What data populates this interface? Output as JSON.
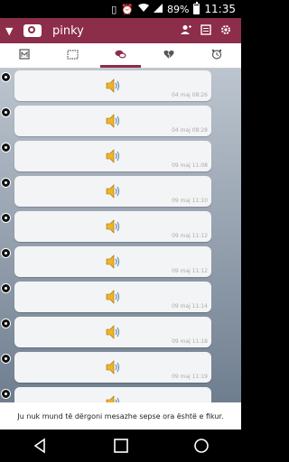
{
  "status_bar": {
    "battery": "89%",
    "time": "11:35",
    "icons": [
      "vibrate-icon",
      "alarm-icon",
      "wifi-icon",
      "signal-icon",
      "battery-icon"
    ]
  },
  "app_bar": {
    "title": "pinky",
    "actions": [
      "add-contact-icon",
      "notes-icon",
      "settings-icon"
    ]
  },
  "tabs": [
    {
      "name": "tab-profile",
      "icon": "profile-card-icon",
      "active": false
    },
    {
      "name": "tab-album",
      "icon": "photo-frame-icon",
      "active": false
    },
    {
      "name": "tab-chat",
      "icon": "chat-bubbles-icon",
      "active": true
    },
    {
      "name": "tab-broken-heart",
      "icon": "broken-heart-icon",
      "active": false
    },
    {
      "name": "tab-alarm",
      "icon": "alarm-clock-icon",
      "active": false
    }
  ],
  "messages": [
    {
      "type": "audio",
      "time": "04 maj 08:26"
    },
    {
      "type": "audio",
      "time": "04 maj 08:28"
    },
    {
      "type": "audio",
      "time": "09 maj 11:08"
    },
    {
      "type": "audio",
      "time": "09 maj 11:10"
    },
    {
      "type": "audio",
      "time": "09 maj 11:12"
    },
    {
      "type": "audio",
      "time": "09 maj 11:12"
    },
    {
      "type": "audio",
      "time": "09 maj 11:14"
    },
    {
      "type": "audio",
      "time": "09 maj 11:18"
    },
    {
      "type": "audio",
      "time": "09 maj 11:19"
    },
    {
      "type": "audio",
      "time": ""
    }
  ],
  "notice": "Ju nuk mund të dërgoni mesazhe sepse ora është e fikur.",
  "colors": {
    "accent": "#8c2d4a",
    "chat_top": "#bcc5cf",
    "chat_bottom": "#6f7e8f",
    "bubble": "#f3f4f5"
  }
}
